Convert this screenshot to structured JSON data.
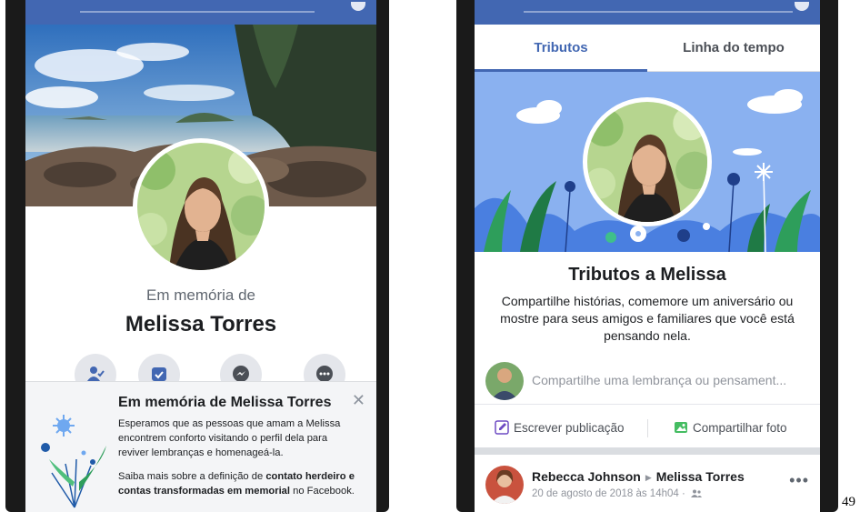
{
  "left_screen": {
    "memorial_prefix": "Em memória de",
    "memorial_name": "Melissa Torres",
    "actions": [
      "friends-icon",
      "memories-icon",
      "messenger-icon",
      "more-icon"
    ],
    "info_card": {
      "title": "Em memória de Melissa Torres",
      "close": "✕",
      "paragraph1": "Esperamos que as pessoas que amam a Melissa encontrem conforto visitando o perfil dela para reviver lembranças e homenageá-la.",
      "paragraph2_prefix": "Saiba mais sobre a definição de ",
      "paragraph2_bold": "contato herdeiro e contas transformadas em memorial",
      "paragraph2_suffix": " no Facebook."
    }
  },
  "right_screen": {
    "tabs": [
      {
        "label": "Tributos",
        "active": true
      },
      {
        "label": "Linha do tempo",
        "active": false
      }
    ],
    "tributes_title": "Tributos a Melissa",
    "tributes_description": "Compartilhe histórias, comemore um aniversário ou mostre para seus amigos e familiares que você está pensando nela.",
    "composer_placeholder": "Compartilhe uma lembrança ou pensament...",
    "write_post_label": "Escrever publicação",
    "share_photo_label": "Compartilhar foto",
    "post": {
      "author": "Rebecca Johnson",
      "target": "Melissa Torres",
      "timestamp": "20 de agosto de 2018 às 14h04 ·",
      "more": "•••"
    }
  },
  "page_number": "49",
  "colors": {
    "facebook_blue": "#4267b2",
    "banner_blue": "#8ab1f0",
    "card_background": "#f4f5f7"
  }
}
